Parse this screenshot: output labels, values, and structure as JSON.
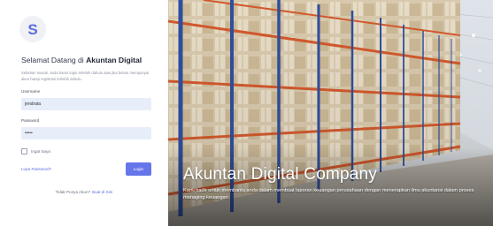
{
  "login": {
    "logo_letter": "S",
    "welcome_prefix": "Selamat Datang di",
    "welcome_brand": "Akuntan Digital",
    "intro_text": "Sebelum masuk, anda harus login terlebih dahulu atau jika belum mempunyai akun harap registrasi terlebih dahulu",
    "username_label": "Username",
    "username_value": "jendrata",
    "password_label": "Password",
    "password_value": "•••••",
    "remember_label": "Ingat Saya",
    "forgot_link": "Lupa Password?",
    "login_button": "Login",
    "signup_prompt": "Tidak Punya Akun?",
    "signup_link": "Buat di Sini"
  },
  "hero": {
    "title": "Akuntan Digital Company",
    "description": "Kami hadir untuk membantu anda dalam membuat laporan keuangan perusahaan dengan menerapkan ilmu akuntansi dalam proses managing keuangan"
  },
  "colors": {
    "accent": "#6576ea",
    "input_bg": "#e8edfa",
    "rack_orange": "#d2592c",
    "rack_blue": "#2f4f9e"
  },
  "icons": {
    "logo": "s-logo-icon"
  }
}
